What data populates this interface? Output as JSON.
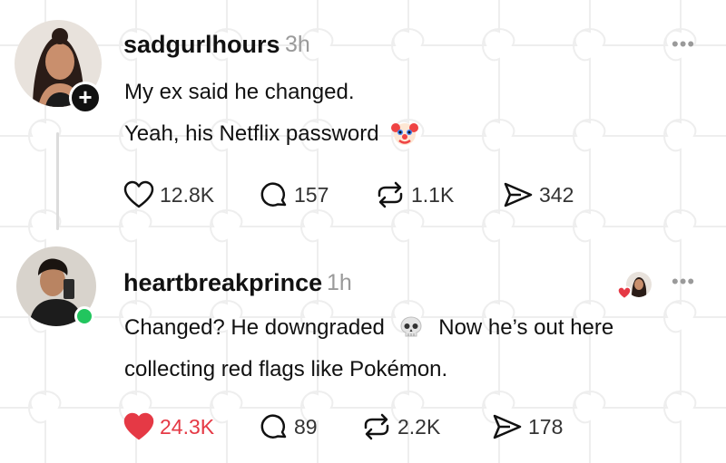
{
  "posts": [
    {
      "username": "sadgurlhours",
      "time": "3h",
      "lines": [
        "My ex said he changed.",
        "Yeah, his Netflix password"
      ],
      "line_emoji": "clown-face",
      "likes": "12.8K",
      "comments": "157",
      "reposts": "1.1K",
      "shares": "342",
      "liked": false,
      "more": "•••"
    },
    {
      "username": "heartbreakprince",
      "time": "1h",
      "lines": [
        "Changed? He downgraded",
        "Now he’s out here",
        "collecting red flags like Pokémon."
      ],
      "line_emoji": "skull",
      "likes": "24.3K",
      "comments": "89",
      "reposts": "2.2K",
      "shares": "178",
      "liked": true,
      "more": "•••"
    }
  ],
  "colors": {
    "like_active": "#e53945",
    "online": "#22c55e",
    "muted": "#9a9a9a"
  }
}
